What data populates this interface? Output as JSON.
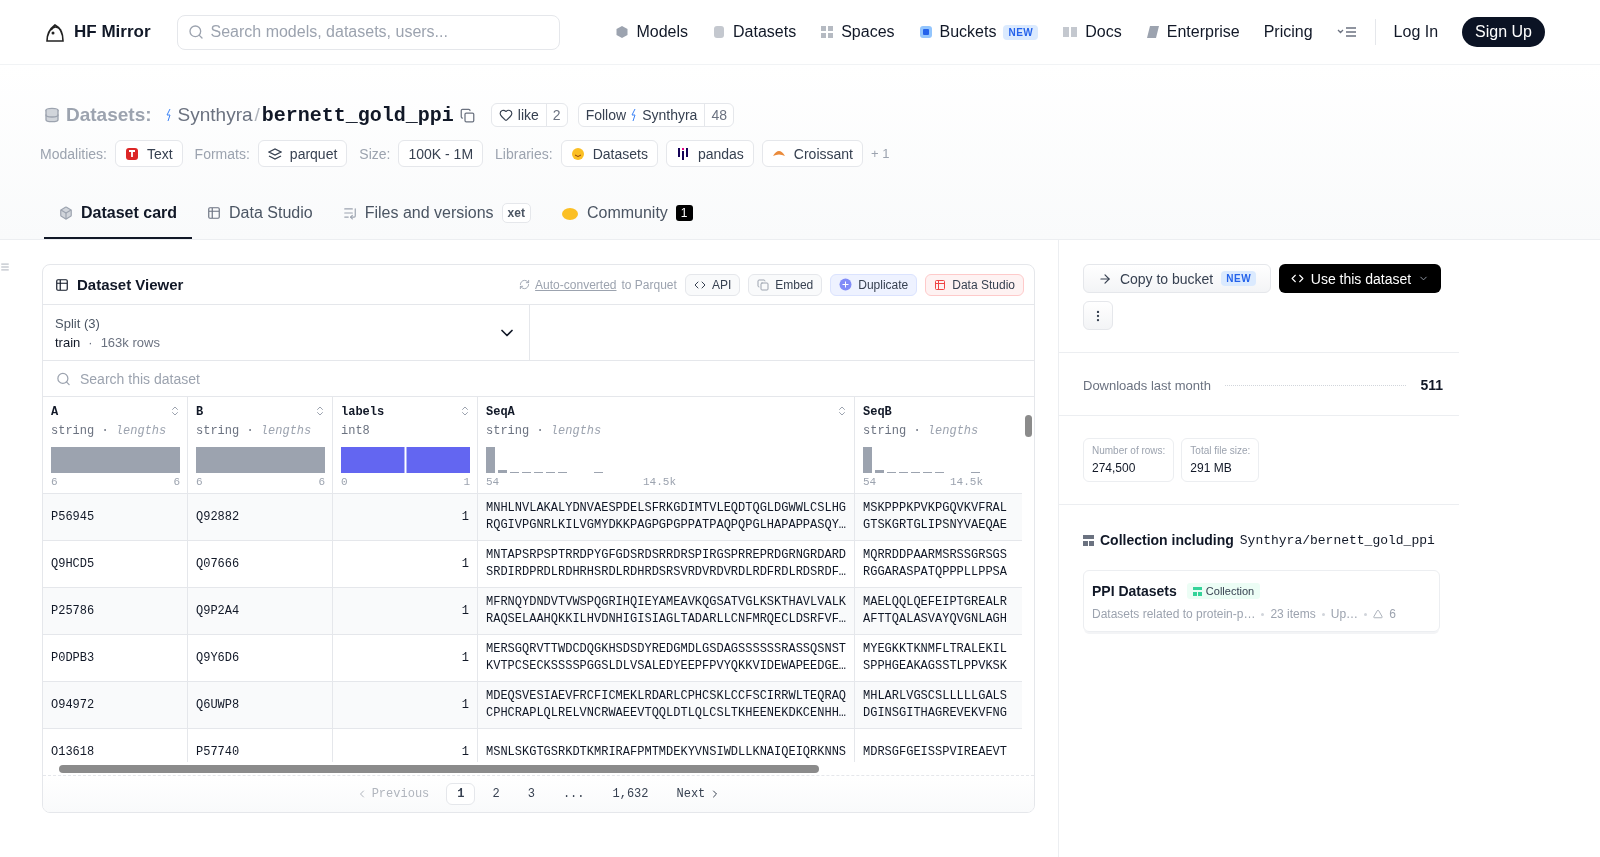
{
  "header": {
    "brand": "HF Mirror",
    "search": {
      "placeholder": "Search models, datasets, users..."
    },
    "nav": [
      {
        "label": "Models"
      },
      {
        "label": "Datasets"
      },
      {
        "label": "Spaces"
      },
      {
        "label": "Buckets",
        "badge": "NEW"
      },
      {
        "label": "Docs"
      },
      {
        "label": "Enterprise"
      },
      {
        "label": "Pricing"
      }
    ],
    "login": "Log In",
    "signup": "Sign Up"
  },
  "repo": {
    "type_label": "Datasets:",
    "owner": "Synthyra",
    "separator": "/",
    "name": "bernett_gold_ppi",
    "like": {
      "label": "like",
      "count": "2"
    },
    "follow": {
      "label": "Follow",
      "org": "Synthyra",
      "count": "48"
    }
  },
  "meta": [
    {
      "label": "Modalities:",
      "chips": [
        "Text"
      ]
    },
    {
      "label": "Formats:",
      "chips": [
        "parquet"
      ]
    },
    {
      "label": "Size:",
      "chips": [
        "100K - 1M"
      ]
    },
    {
      "label": "Libraries:",
      "chips": [
        "Datasets",
        "pandas",
        "Croissant"
      ],
      "more": "+ 1"
    }
  ],
  "tabs": [
    {
      "label": "Dataset card",
      "selected": true
    },
    {
      "label": "Data Studio",
      "selected": false
    },
    {
      "label": "Files and versions",
      "selected": false,
      "badge": "xet"
    },
    {
      "label": "Community",
      "selected": false,
      "count": "1"
    }
  ],
  "viewer": {
    "title": "Dataset Viewer",
    "converted_link": "Auto-converted",
    "converted_text": "to Parquet",
    "actions": [
      {
        "label": "API",
        "kind": "plain"
      },
      {
        "label": "Embed",
        "kind": "plain"
      },
      {
        "label": "Duplicate",
        "kind": "duplicate"
      },
      {
        "label": "Data Studio",
        "kind": "studio"
      }
    ],
    "split": {
      "label": "Split (3)",
      "value": "train",
      "separator": "·",
      "rows": "163k rows"
    },
    "search": {
      "placeholder": "Search this dataset"
    },
    "columns": [
      {
        "name": "A",
        "type": "string",
        "separator": "·",
        "detail": "lengths",
        "kind": "single",
        "min": "6",
        "max": "6"
      },
      {
        "name": "B",
        "type": "string",
        "separator": "·",
        "detail": "lengths",
        "kind": "single",
        "min": "6",
        "max": "6"
      },
      {
        "name": "labels",
        "type": "int8",
        "kind": "binary",
        "min": "0",
        "max": "1"
      },
      {
        "name": "SeqA",
        "type": "string",
        "separator": "·",
        "detail": "lengths",
        "kind": "skewed",
        "min": "54",
        "max": "14.5k"
      },
      {
        "name": "SeqB",
        "type": "string",
        "separator": "·",
        "detail": "lengths",
        "kind": "skewed",
        "min": "54",
        "max": "14.5k"
      }
    ],
    "rows": [
      {
        "cells": [
          "P56945",
          "Q92882",
          "1",
          "MNHLNVLAKALYDNVAESPDELSFRKGDIMTVLEQDTQGLDGWWLCSLHG\nRQGIVPGNRLKILVGMYDKKPAGPGPGPPATPAQPQPGLHAPAPPASQY…",
          "MSKPPPKPVKPGQVKVFRAL\nGTSKGRTGLIPSNYVAEQAE"
        ]
      },
      {
        "cells": [
          "Q9HCD5",
          "Q07666",
          "1",
          "MNTAPSRPSPTRRDPYGFGDSRDSRRDRSPIRGSPRREPRDGRNGRDARD\nSRDIRDPRDLRDHRHSRDLRDHRDSRSVRDVRDVRDLRDFRDLRDSRDF…",
          "MQRRDDPAARMSRSSGRSGS\nRGGARASPATQPPPLLPPSA"
        ]
      },
      {
        "cells": [
          "P25786",
          "Q9P2A4",
          "1",
          "MFRNQYDNDVTVWSPQGRIHQIEYAMEAVKQGSATVGLKSKTHAVLVALK\nRAQSELAAHQKKILHVDNHIGISIAGLTADARLLCNFMRQECLDSRFVF…",
          "MAELQQLQEFEIPTGREALR\nAFTTQALASVAYQVGNLAGH"
        ]
      },
      {
        "cells": [
          "P0DPB3",
          "Q9Y6D6",
          "1",
          "MERSGQRVTTWDCDQGKHSDSDYREDGMDLGSDAGSSSSSSRASSQSNST\nKVTPCSECKSSSSPGGSLDLVSALEDYEEPFPVYQKKVIDEWAPEEDGE…",
          "MYEGKKTKNMFLTRALEKIL\nSPPHGEAKAGSSTLPPVKSK"
        ]
      },
      {
        "cells": [
          "O94972",
          "Q6UWP8",
          "1",
          "MDEQSVESIAEVFRCFICMEKLRDARLCPHCSKLCCFSCIRRWLTEQRAQ\nCPHCRAPLQLRELVNCRWAEEVTQQLDTLQLCSLTKHEENEKDKCENHH…",
          "MHLARLVGSCSLLLLLGALS\nDGINSGITHAGREVEKVFNG"
        ]
      },
      {
        "cells": [
          "O13618",
          "P57740",
          "1",
          "MSNLSKGTGSRKDTKMRIRAFPMTMDEKYVNSIWDLLKNAIQEIQRKNNS",
          "MDRSGFGEISSPVIREAEVT"
        ]
      }
    ],
    "pagination": {
      "previous": {
        "label": "Previous",
        "disabled": true
      },
      "pages": [
        {
          "label": "1",
          "selected": true
        },
        {
          "label": "2",
          "selected": false
        },
        {
          "label": "3",
          "selected": false
        },
        {
          "label": "...",
          "selected": false
        },
        {
          "label": "1,632",
          "selected": false
        }
      ],
      "next": {
        "label": "Next",
        "disabled": false
      }
    }
  },
  "sidebar": {
    "copy": {
      "label": "Copy to bucket",
      "badge": "NEW"
    },
    "use": "Use this dataset",
    "downloads": {
      "label": "Downloads last month",
      "value": "511"
    },
    "stats": [
      {
        "label": "Number of rows:",
        "value": "274,500"
      },
      {
        "label": "Total file size:",
        "value": "291 MB"
      }
    ],
    "collection": {
      "heading": "Collection including",
      "repo": "Synthyra/bernett_gold_ppi",
      "title": "PPI Datasets",
      "tag": "Collection",
      "description": "Datasets related to protein-p…",
      "items": "23 items",
      "updated": "Up…",
      "upvotes": "6"
    }
  }
}
